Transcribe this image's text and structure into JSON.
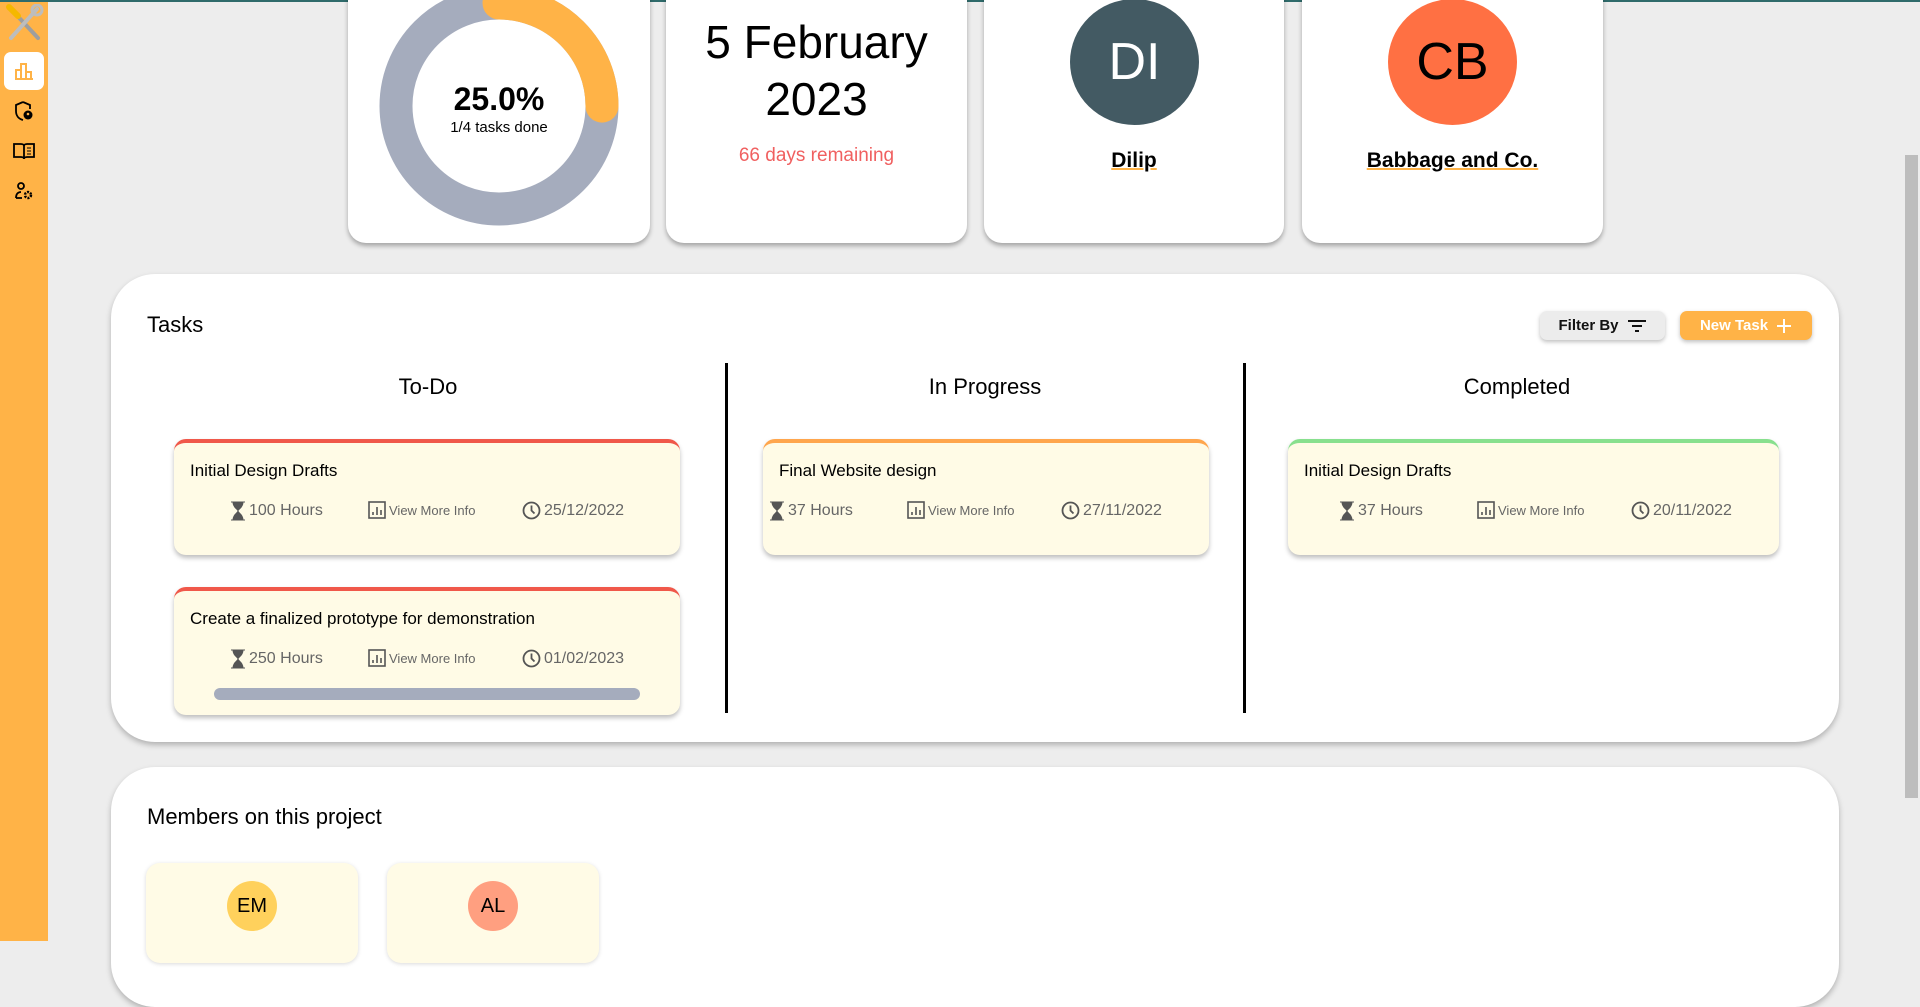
{
  "sidebar": {
    "items": [
      {
        "icon": "bar-chart-icon",
        "active": true
      },
      {
        "icon": "shield-user-icon"
      },
      {
        "icon": "book-icon"
      },
      {
        "icon": "user-settings-icon"
      }
    ]
  },
  "progress": {
    "percent_label": "25.0%",
    "tasks_label": "1/4 tasks done",
    "fraction": 0.25,
    "done_color": "#ffb347",
    "track_color": "#a5acbd"
  },
  "deadline": {
    "date_line1": "5 February",
    "date_line2": "2023",
    "remaining": "66 days remaining"
  },
  "manager": {
    "initials": "DI",
    "name": "Dilip",
    "color": "#435a63"
  },
  "client": {
    "initials": "CB",
    "name": "Babbage and Co.",
    "color": "#ff7043"
  },
  "tasks": {
    "title": "Tasks",
    "filter_label": "Filter By",
    "new_label": "New Task",
    "columns": [
      {
        "title": "To-Do",
        "cards": [
          {
            "name": "Initial Design Drafts",
            "hours": "100 Hours",
            "info": "View More Info",
            "date": "25/12/2022"
          },
          {
            "name": "Create a finalized prototype for demonstration",
            "hours": "250 Hours",
            "info": "View More Info",
            "date": "01/02/2023"
          }
        ]
      },
      {
        "title": "In Progress",
        "cards": [
          {
            "name": "Final Website design",
            "hours": "37 Hours",
            "info": "View More Info",
            "date": "27/11/2022"
          }
        ]
      },
      {
        "title": "Completed",
        "cards": [
          {
            "name": "Initial Design Drafts",
            "hours": "37 Hours",
            "info": "View More Info",
            "date": "20/11/2022"
          }
        ]
      }
    ]
  },
  "members": {
    "title": "Members on this project",
    "list": [
      {
        "initials": "EM",
        "color": "#ffd15c"
      },
      {
        "initials": "AL",
        "color": "#ff9f80"
      }
    ]
  }
}
